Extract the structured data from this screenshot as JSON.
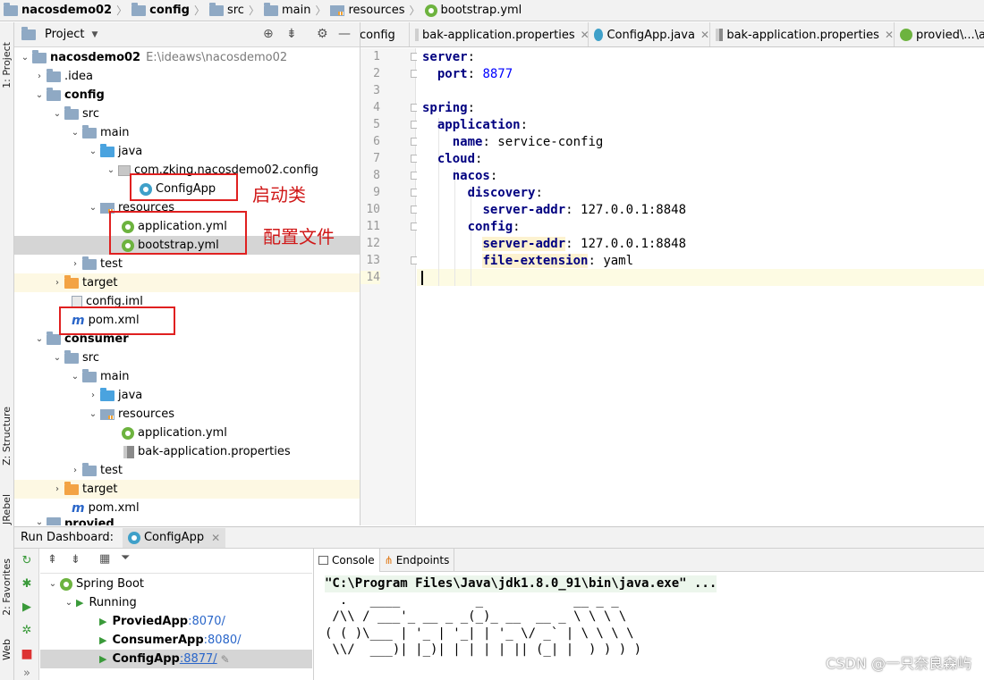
{
  "breadcrumb": [
    "nacosdemo02",
    "config",
    "src",
    "main",
    "resources",
    "bootstrap.yml"
  ],
  "left_stripe": {
    "project": "1: Project",
    "structure": "Z: Structure",
    "jrebel": "JRebel",
    "favorites": "2: Favorites",
    "web": "Web"
  },
  "project_panel": {
    "title": "Project",
    "tree": [
      {
        "label": "nacosdemo02",
        "path": "E:\\ideaws\\nacosdemo02",
        "bold": true
      },
      {
        "label": ".idea"
      },
      {
        "label": "config",
        "bold": true
      },
      {
        "label": "src"
      },
      {
        "label": "main"
      },
      {
        "label": "java"
      },
      {
        "label": "com.zking.nacosdemo02.config"
      },
      {
        "label": "ConfigApp"
      },
      {
        "label": "resources"
      },
      {
        "label": "application.yml"
      },
      {
        "label": "bootstrap.yml"
      },
      {
        "label": "test"
      },
      {
        "label": "target"
      },
      {
        "label": "config.iml"
      },
      {
        "label": "pom.xml"
      },
      {
        "label": "consumer",
        "bold": true
      },
      {
        "label": "src"
      },
      {
        "label": "main"
      },
      {
        "label": "java"
      },
      {
        "label": "resources"
      },
      {
        "label": "application.yml"
      },
      {
        "label": "bak-application.properties"
      },
      {
        "label": "test"
      },
      {
        "label": "target"
      },
      {
        "label": "pom.xml"
      },
      {
        "label": "provied",
        "bold": true
      }
    ],
    "annotations": {
      "startup_class": "启动类",
      "config_files": "配置文件"
    }
  },
  "editor": {
    "tabs": [
      {
        "label": "config"
      },
      {
        "label": "bak-application.properties"
      },
      {
        "label": "ConfigApp.java"
      },
      {
        "label": "bak-application.properties"
      },
      {
        "label": "provied\\...\\a"
      }
    ],
    "line_numbers": [
      "1",
      "2",
      "3",
      "4",
      "5",
      "6",
      "7",
      "8",
      "9",
      "10",
      "11",
      "12",
      "13",
      "14"
    ],
    "code": {
      "server": "server",
      "port": "port",
      "port_val": "8877",
      "spring": "spring",
      "application": "application",
      "name": "name",
      "name_val": "service-config",
      "cloud": "cloud",
      "nacos": "nacos",
      "discovery": "discovery",
      "server_addr": "server-addr",
      "server_addr_val": "127.0.0.1:8848",
      "config": "config",
      "server_addr2": "server-addr",
      "server_addr_val2": "127.0.0.1:8848",
      "file_ext": "file-extension",
      "file_ext_val": "yaml"
    }
  },
  "run_dashboard": {
    "label": "Run Dashboard:",
    "tab": "ConfigApp",
    "tree": {
      "root": "Spring Boot",
      "running": "Running",
      "apps": [
        {
          "name": "ProviedApp",
          "port": ":8070/"
        },
        {
          "name": "ConsumerApp",
          "port": ":8080/"
        },
        {
          "name": "ConfigApp",
          "port": ":8877/"
        }
      ]
    },
    "console_tabs": [
      "Console",
      "Endpoints"
    ],
    "console_lines": [
      "\"C:\\Program Files\\Java\\jdk1.8.0_91\\bin\\java.exe\" ...",
      "",
      "  .   ____          _            __ _ _",
      " /\\\\ / ___'_ __ _ _(_)_ __  __ _ \\ \\ \\ \\",
      "( ( )\\___ | '_ | '_| | '_ \\/ _` | \\ \\ \\ \\",
      " \\\\/  ___)| |_)| | | | | || (_| |  ) ) ) )"
    ]
  },
  "watermark": "CSDN @一只奈良森屿"
}
